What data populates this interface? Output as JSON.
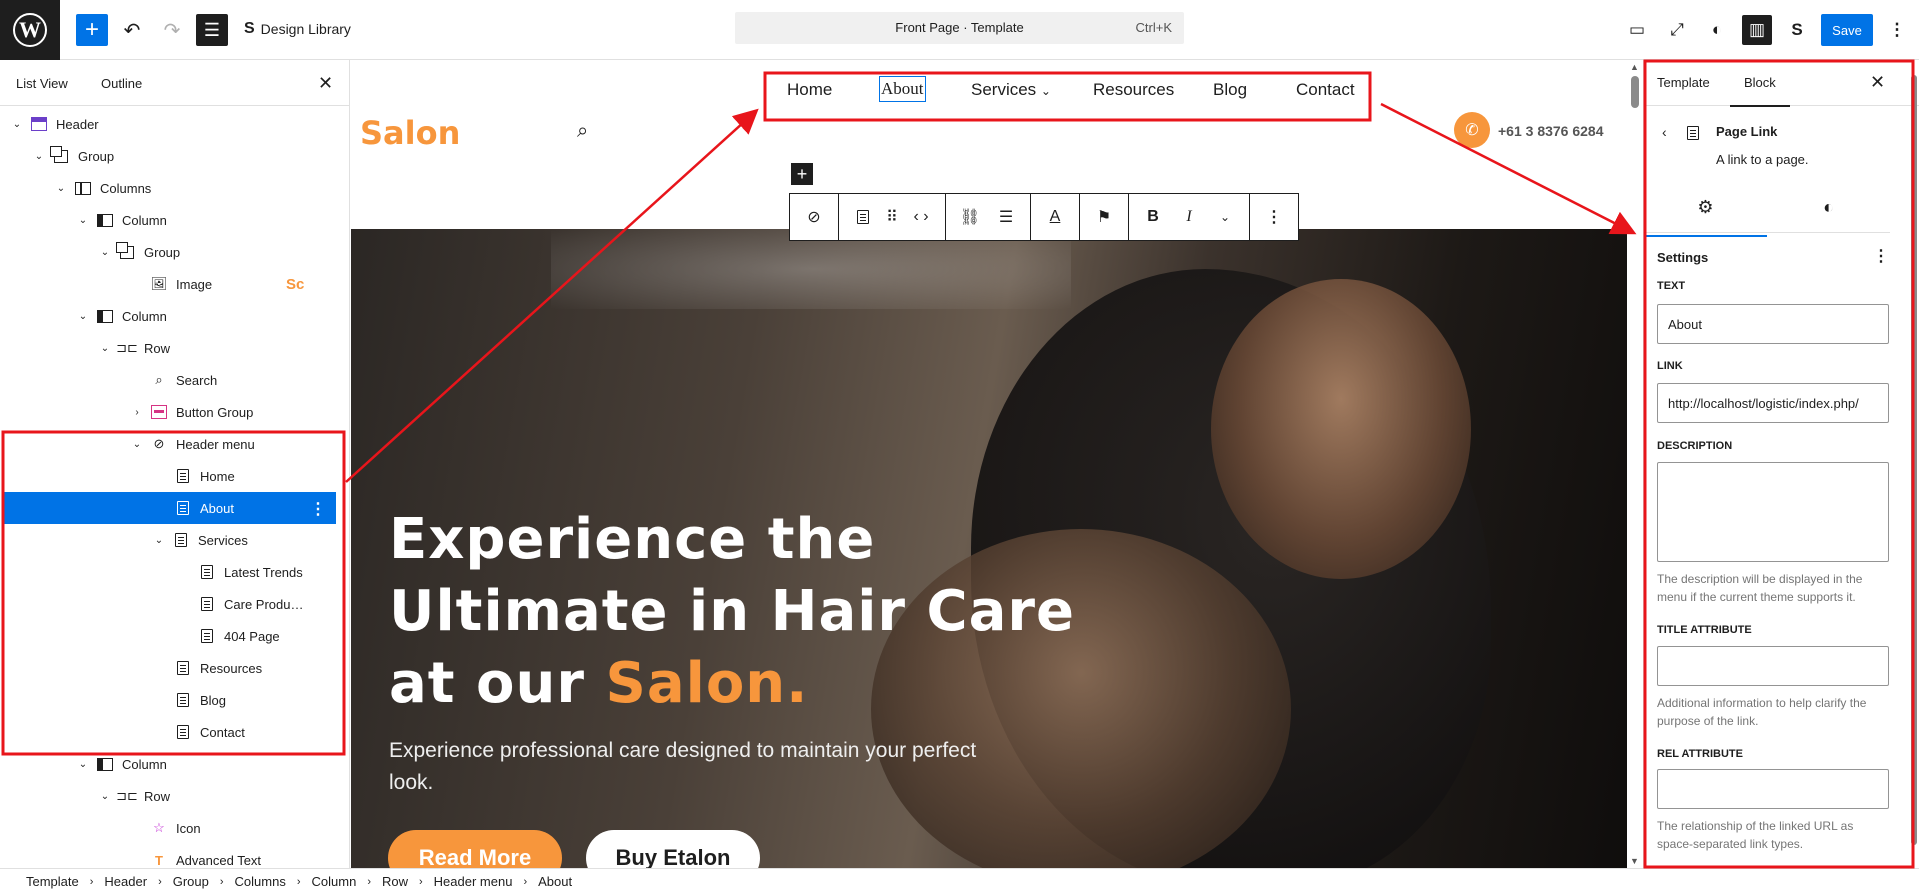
{
  "topbar": {
    "add_label": "+",
    "design_library": "Design Library",
    "document_title": "Front Page · Template",
    "shortcut": "Ctrl+K",
    "save_label": "Save"
  },
  "left_panel": {
    "tabs": [
      "List View",
      "Outline"
    ],
    "close": "✕",
    "tree": [
      {
        "label": "Header",
        "icon": "header-icon"
      },
      {
        "label": "Group",
        "icon": "group-icon"
      },
      {
        "label": "Columns",
        "icon": "columns-icon"
      },
      {
        "label": "Column",
        "icon": "column-icon"
      },
      {
        "label": "Group",
        "icon": "group-icon"
      },
      {
        "label": "Image",
        "icon": "image-icon",
        "side": "Sc"
      },
      {
        "label": "Column",
        "icon": "column-icon"
      },
      {
        "label": "Row",
        "icon": "row-icon"
      },
      {
        "label": "Search",
        "icon": "search-icon"
      },
      {
        "label": "Button Group",
        "icon": "button-group-icon"
      },
      {
        "label": "Header menu",
        "icon": "navigation-icon"
      },
      {
        "label": "Home",
        "icon": "page-icon"
      },
      {
        "label": "About",
        "icon": "page-icon",
        "selected": true
      },
      {
        "label": "Services",
        "icon": "page-icon"
      },
      {
        "label": "Latest Trends",
        "icon": "page-icon"
      },
      {
        "label": "Care Produ…",
        "icon": "page-icon"
      },
      {
        "label": "404 Page",
        "icon": "page-icon"
      },
      {
        "label": "Resources",
        "icon": "page-icon"
      },
      {
        "label": "Blog",
        "icon": "page-icon"
      },
      {
        "label": "Contact",
        "icon": "page-icon"
      },
      {
        "label": "Column",
        "icon": "column-icon"
      },
      {
        "label": "Row",
        "icon": "row-icon"
      },
      {
        "label": "Icon",
        "icon": "star-icon"
      },
      {
        "label": "Advanced Text",
        "icon": "advanced-text-icon"
      }
    ]
  },
  "canvas": {
    "logo": "Salon",
    "nav": [
      "Home",
      "About",
      "Services",
      "Resources",
      "Blog",
      "Contact"
    ],
    "phone": "+61 3 8376 6284",
    "hero": {
      "title_line1": "Experience the",
      "title_line2": "Ultimate in Hair Care",
      "title_line3_a": "at our ",
      "title_line3_b": "Salon.",
      "subtitle": "Experience professional care designed to maintain your perfect look.",
      "btn_primary": "Read More",
      "btn_secondary": "Buy Etalon"
    }
  },
  "right_panel": {
    "tabs": [
      "Template",
      "Block"
    ],
    "close": "✕",
    "block_title": "Page Link",
    "block_desc": "A link to a page.",
    "settings_label": "Settings",
    "fields": {
      "text_label": "TEXT",
      "text_value": "About",
      "link_label": "LINK",
      "link_value": "http://localhost/logistic/index.php/",
      "desc_label": "DESCRIPTION",
      "desc_help": "The description will be displayed in the menu if the current theme supports it.",
      "title_label": "TITLE ATTRIBUTE",
      "title_help": "Additional information to help clarify the purpose of the link.",
      "rel_label": "REL ATTRIBUTE",
      "rel_help": "The relationship of the linked URL as space-separated link types."
    }
  },
  "breadcrumb": [
    "Template",
    "Header",
    "Group",
    "Columns",
    "Column",
    "Row",
    "Header menu",
    "About"
  ],
  "colors": {
    "accent": "#0073e6",
    "brand_orange": "#f7963c",
    "annotation_red": "#e8151b"
  }
}
